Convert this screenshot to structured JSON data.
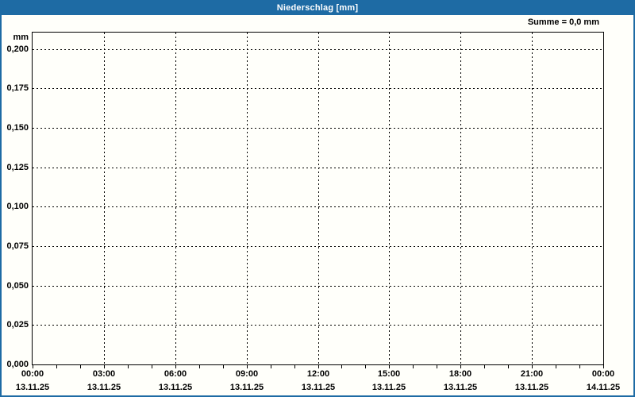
{
  "window": {
    "title": "Niederschlag [mm]"
  },
  "annotation": {
    "sum_label": "Summe = 0,0 mm"
  },
  "colors": {
    "titlebar_bg": "#1e6ba4",
    "title_text": "#ffffff",
    "chart_bg": "#fffffa",
    "grid_and_axis": "#000000",
    "label_text": "#000000"
  },
  "chart_data": {
    "type": "line",
    "title": "Niederschlag [mm]",
    "ylabel": "mm",
    "xlabel": "",
    "ylim": [
      0,
      0.2105
    ],
    "xlim_hours": [
      0,
      24
    ],
    "grid": "dashed-black-on-white",
    "legend_position": "none",
    "annotation": "Summe = 0,0 mm",
    "y_ticks": [
      {
        "value": 0.0,
        "label": "0,000"
      },
      {
        "value": 0.025,
        "label": "0,025"
      },
      {
        "value": 0.05,
        "label": "0,050"
      },
      {
        "value": 0.075,
        "label": "0,075"
      },
      {
        "value": 0.1,
        "label": "0,100"
      },
      {
        "value": 0.125,
        "label": "0,125"
      },
      {
        "value": 0.15,
        "label": "0,150"
      },
      {
        "value": 0.175,
        "label": "0,175"
      },
      {
        "value": 0.2,
        "label": "0,200"
      }
    ],
    "x_ticks": [
      {
        "hour": 0,
        "time": "00:00",
        "date": "13.11.25"
      },
      {
        "hour": 3,
        "time": "03:00",
        "date": "13.11.25"
      },
      {
        "hour": 6,
        "time": "06:00",
        "date": "13.11.25"
      },
      {
        "hour": 9,
        "time": "09:00",
        "date": "13.11.25"
      },
      {
        "hour": 12,
        "time": "12:00",
        "date": "13.11.25"
      },
      {
        "hour": 15,
        "time": "15:00",
        "date": "13.11.25"
      },
      {
        "hour": 18,
        "time": "18:00",
        "date": "13.11.25"
      },
      {
        "hour": 21,
        "time": "21:00",
        "date": "13.11.25"
      },
      {
        "hour": 24,
        "time": "00:00",
        "date": "14.11.25"
      }
    ],
    "minor_tick_every_hours": 1,
    "series": [
      {
        "name": "Niederschlag",
        "sum_mm": 0.0,
        "values": []
      }
    ]
  }
}
